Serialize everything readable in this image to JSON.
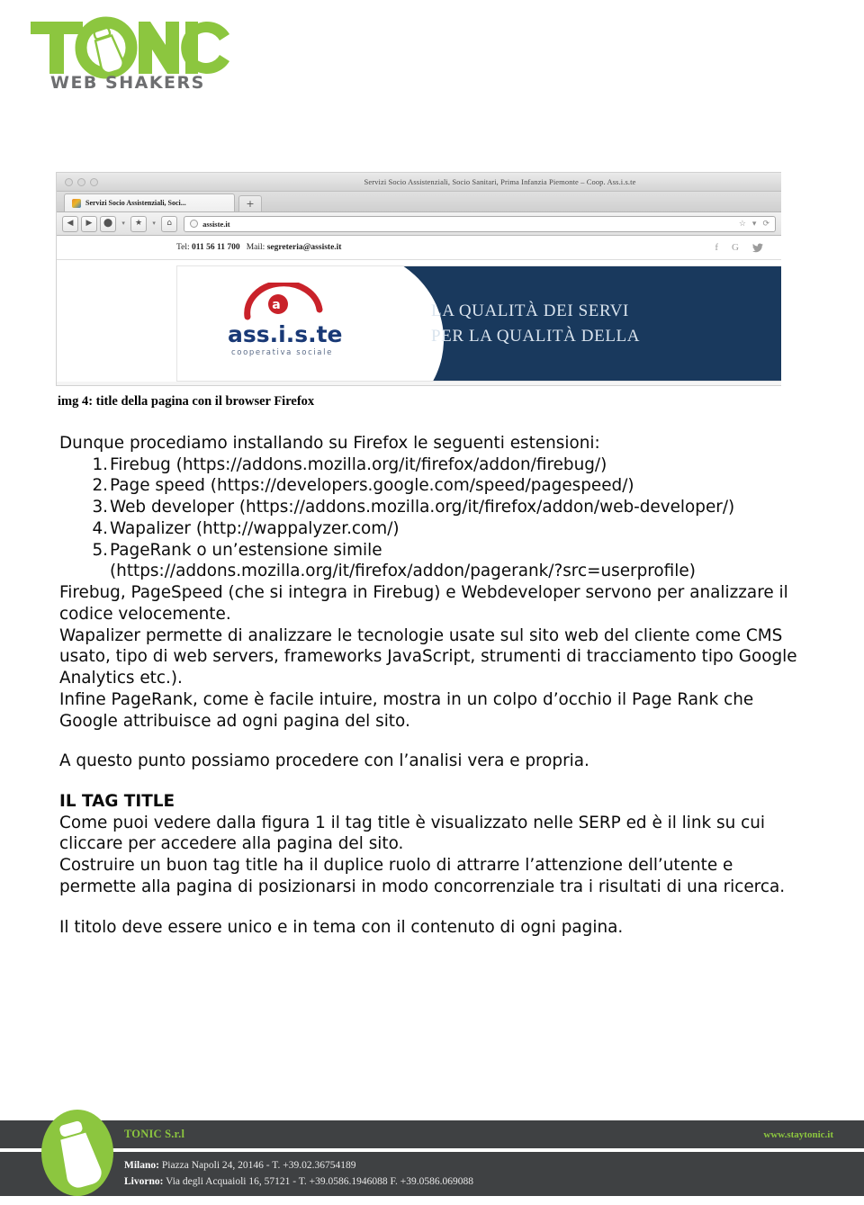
{
  "brand": {
    "logo_word": "TONIC",
    "logo_tagline": "WEB SHAKERS",
    "green": "#8cc63f",
    "gray": "#6d6e70"
  },
  "figure": {
    "browser": {
      "window_title": "Servizi Socio Assistenziali, Socio Sanitari, Prima Infanzia Piemonte – Coop. Ass.i.s.te",
      "tab_label": "Servizi Socio Assistenziali, Soci...",
      "new_tab_label": "+",
      "back_icon": "◀",
      "forward_icon": "▶",
      "reload_icon": "⬤",
      "bookmark_icon": "★",
      "home_icon": "⌂",
      "dropdown_icon": "▾",
      "url": "assiste.it",
      "star_icon": "☆",
      "refresh_icon": "⟳"
    },
    "site": {
      "phone_label": "Tel:",
      "phone": "011 56 11 700",
      "mail_label": "Mail:",
      "mail": "segreteria@assiste.it",
      "social": [
        "f",
        "G",
        "🐦"
      ],
      "logo_main": "ass.i.s.te",
      "logo_sub": "cooperativa sociale",
      "banner_line1": "LA QUALITÀ DEI SERVI",
      "banner_line2": "PER LA QUALITÀ DELLA",
      "banner_blue": "#1b3a5e"
    },
    "caption": "img 4: title della pagina con il browser Firefox"
  },
  "content": {
    "intro": "Dunque procediamo installando su Firefox le seguenti estensioni:",
    "steps": [
      {
        "num": "1.",
        "text": "Firebug (https://addons.mozilla.org/it/firefox/addon/firebug/)"
      },
      {
        "num": "2.",
        "text": "Page speed (https://developers.google.com/speed/pagespeed/)"
      },
      {
        "num": "3.",
        "text": "Web developer (https://addons.mozilla.org/it/firefox/addon/web-developer/)"
      },
      {
        "num": "4.",
        "text": "Wapalizer (http://wappalyzer.com/)"
      },
      {
        "num": "5.",
        "text": "PageRank o un’estensione simile (https://addons.mozilla.org/it/firefox/addon/pagerank/?src=userprofile)"
      }
    ],
    "para1": "Firebug, PageSpeed (che si integra in Firebug) e Webdeveloper servono per analizzare il codice velocemente.",
    "para2": "Wapalizer permette di analizzare le tecnologie usate sul sito web del cliente come CMS usato, tipo di web servers, frameworks JavaScript, strumenti di tracciamento tipo Google Analytics etc.).",
    "para3": "Infine PageRank, come è facile intuire, mostra in un colpo d’occhio il Page Rank che Google attribuisce ad ogni pagina del sito.",
    "para4": "A questo punto possiamo procedere con l’analisi vera e propria.",
    "heading": "IL TAG TITLE",
    "para5": "Come puoi vedere dalla figura 1 il tag title è visualizzato nelle SERP ed è il link su cui cliccare per accedere alla pagina del sito.",
    "para6": "Costruire un buon tag title ha il duplice ruolo di attrarre l’attenzione dell’utente e permette alla pagina di posizionarsi in modo concorrenziale tra i risultati di una ricerca.",
    "para7": "Il titolo deve essere unico e in tema con il contenuto di ogni pagina."
  },
  "footer": {
    "company": "TONIC S.r.l",
    "website": "www.staytonic.it",
    "office1_city": "Milano:",
    "office1_rest": " Piazza Napoli 24, 20146 - T. +39.02.36754189",
    "office2_city": "Livorno:",
    "office2_rest": " Via degli Acquaioli 16, 57121 - T. +39.0586.1946088  F. +39.0586.069088",
    "dark": "#3f4143"
  }
}
